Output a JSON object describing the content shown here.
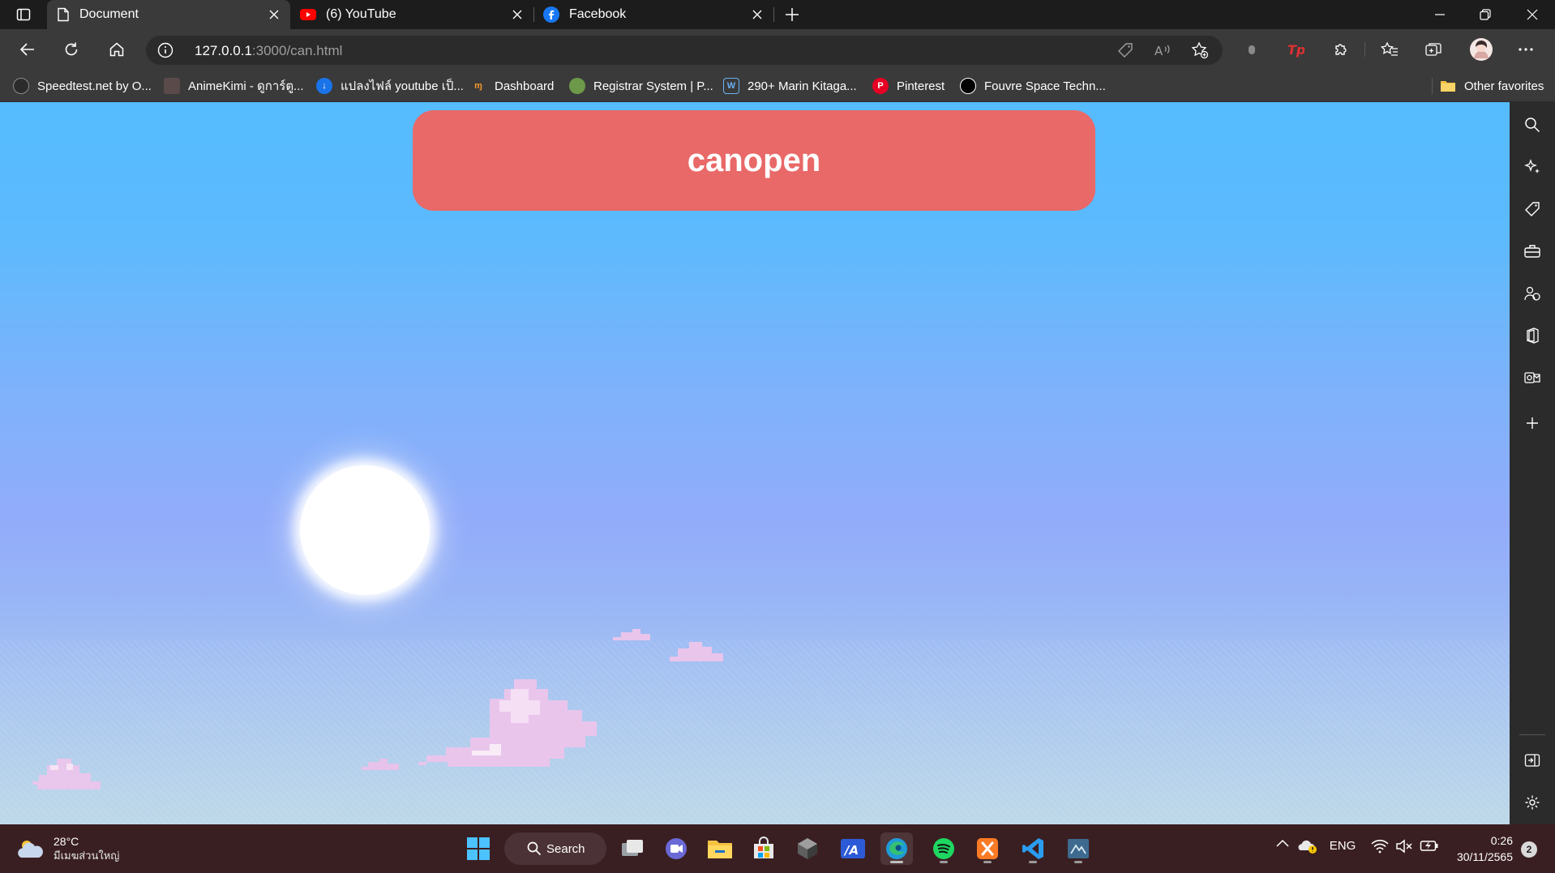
{
  "browser": {
    "tabs": [
      {
        "title": "Document",
        "icon": "page-icon",
        "active": true
      },
      {
        "title": "(6) YouTube",
        "icon": "youtube-icon",
        "active": false
      },
      {
        "title": "Facebook",
        "icon": "facebook-icon",
        "active": false
      }
    ],
    "address": {
      "host": "127.0.0.1",
      "path": ":3000/can.html"
    },
    "favorites": [
      {
        "label": "Speedtest.net by O...",
        "icon": "speedtest-icon"
      },
      {
        "label": "AnimeKimi - ดูการ์ตู...",
        "icon": "animekimi-icon"
      },
      {
        "label": "แปลงไฟล์ youtube เป็...",
        "icon": "converter-icon"
      },
      {
        "label": "Dashboard",
        "icon": "dashboard-icon"
      },
      {
        "label": "Registrar System | P...",
        "icon": "registrar-icon"
      },
      {
        "label": "290+ Marin Kitaga...",
        "icon": "marin-icon"
      },
      {
        "label": "Pinterest",
        "icon": "pinterest-icon"
      },
      {
        "label": "Fouvre Space Techn...",
        "icon": "fouvre-icon"
      }
    ],
    "other_favorites": "Other favorites"
  },
  "page": {
    "heading": "canopen",
    "heading_color": "#e96868"
  },
  "taskbar": {
    "weather": {
      "temp": "28°C",
      "location": "มีเมฆส่วนใหญ่"
    },
    "search_label": "Search",
    "language": "ENG",
    "time": "0:26",
    "date": "30/11/2565",
    "notification_count": "2"
  }
}
